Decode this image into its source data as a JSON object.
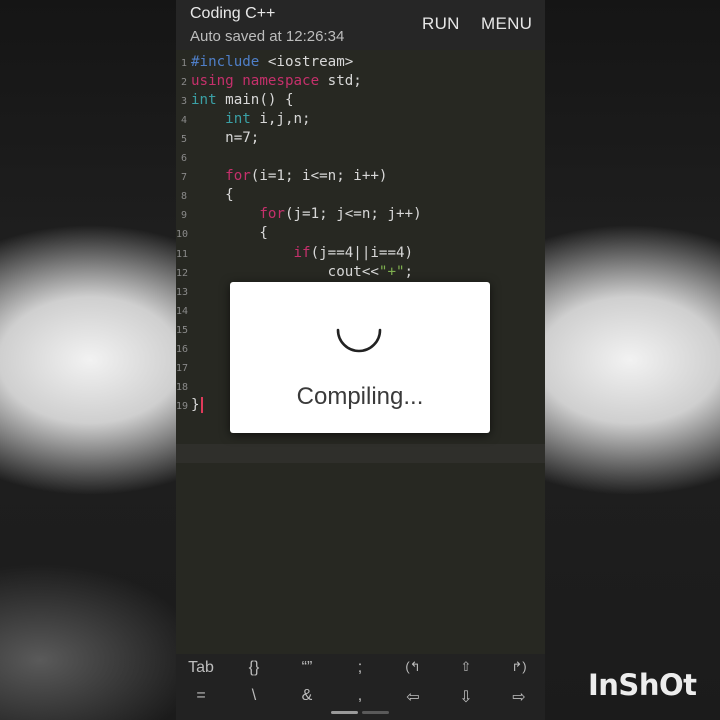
{
  "app": {
    "title": "Coding C++",
    "autosave": "Auto saved at 12:26:34",
    "run_label": "RUN",
    "menu_label": "MENU"
  },
  "editor": {
    "line_numbers": [
      "1",
      "2",
      "3",
      "4",
      "5",
      "6",
      "7",
      "8",
      "9",
      "10",
      "11",
      "12",
      "13",
      "14",
      "15",
      "16",
      "17",
      "18",
      "19"
    ],
    "lines": [
      [
        {
          "t": "#include",
          "c": "kw-blue"
        },
        {
          "t": " <iostream>",
          "c": ""
        }
      ],
      [
        {
          "t": "using",
          "c": "kw-pink"
        },
        {
          "t": " ",
          "c": ""
        },
        {
          "t": "namespace",
          "c": "kw-pink"
        },
        {
          "t": " std;",
          "c": ""
        }
      ],
      [
        {
          "t": "int",
          "c": "kw-type"
        },
        {
          "t": " main() {",
          "c": ""
        }
      ],
      [
        {
          "t": "    ",
          "c": ""
        },
        {
          "t": "int",
          "c": "kw-type"
        },
        {
          "t": " i,j,n;",
          "c": ""
        }
      ],
      [
        {
          "t": "    n=7;",
          "c": ""
        }
      ],
      [],
      [
        {
          "t": "    ",
          "c": ""
        },
        {
          "t": "for",
          "c": "kw-pink"
        },
        {
          "t": "(i=1; i<=n; i++)",
          "c": ""
        }
      ],
      [
        {
          "t": "    {",
          "c": ""
        }
      ],
      [
        {
          "t": "        ",
          "c": ""
        },
        {
          "t": "for",
          "c": "kw-pink"
        },
        {
          "t": "(j=1; j<=n; j++)",
          "c": ""
        }
      ],
      [
        {
          "t": "        {",
          "c": ""
        }
      ],
      [
        {
          "t": "            ",
          "c": ""
        },
        {
          "t": "if",
          "c": "kw-pink"
        },
        {
          "t": "(j==4||i==4)",
          "c": ""
        }
      ],
      [
        {
          "t": "                cout<<",
          "c": ""
        },
        {
          "t": "\"+\"",
          "c": "str"
        },
        {
          "t": ";",
          "c": ""
        }
      ],
      [],
      [],
      [],
      [],
      [],
      [],
      [
        {
          "t": "}",
          "c": ""
        }
      ]
    ]
  },
  "dialog": {
    "message": "Compiling..."
  },
  "keyboard": {
    "row1": [
      "Tab",
      "{}",
      "“”",
      ";",
      "(↰",
      "⇧",
      "↱)"
    ],
    "row2": [
      "=",
      "\\",
      "&",
      ",",
      "⇦",
      "⇩",
      "⇨"
    ]
  },
  "watermark": "InShOt"
}
